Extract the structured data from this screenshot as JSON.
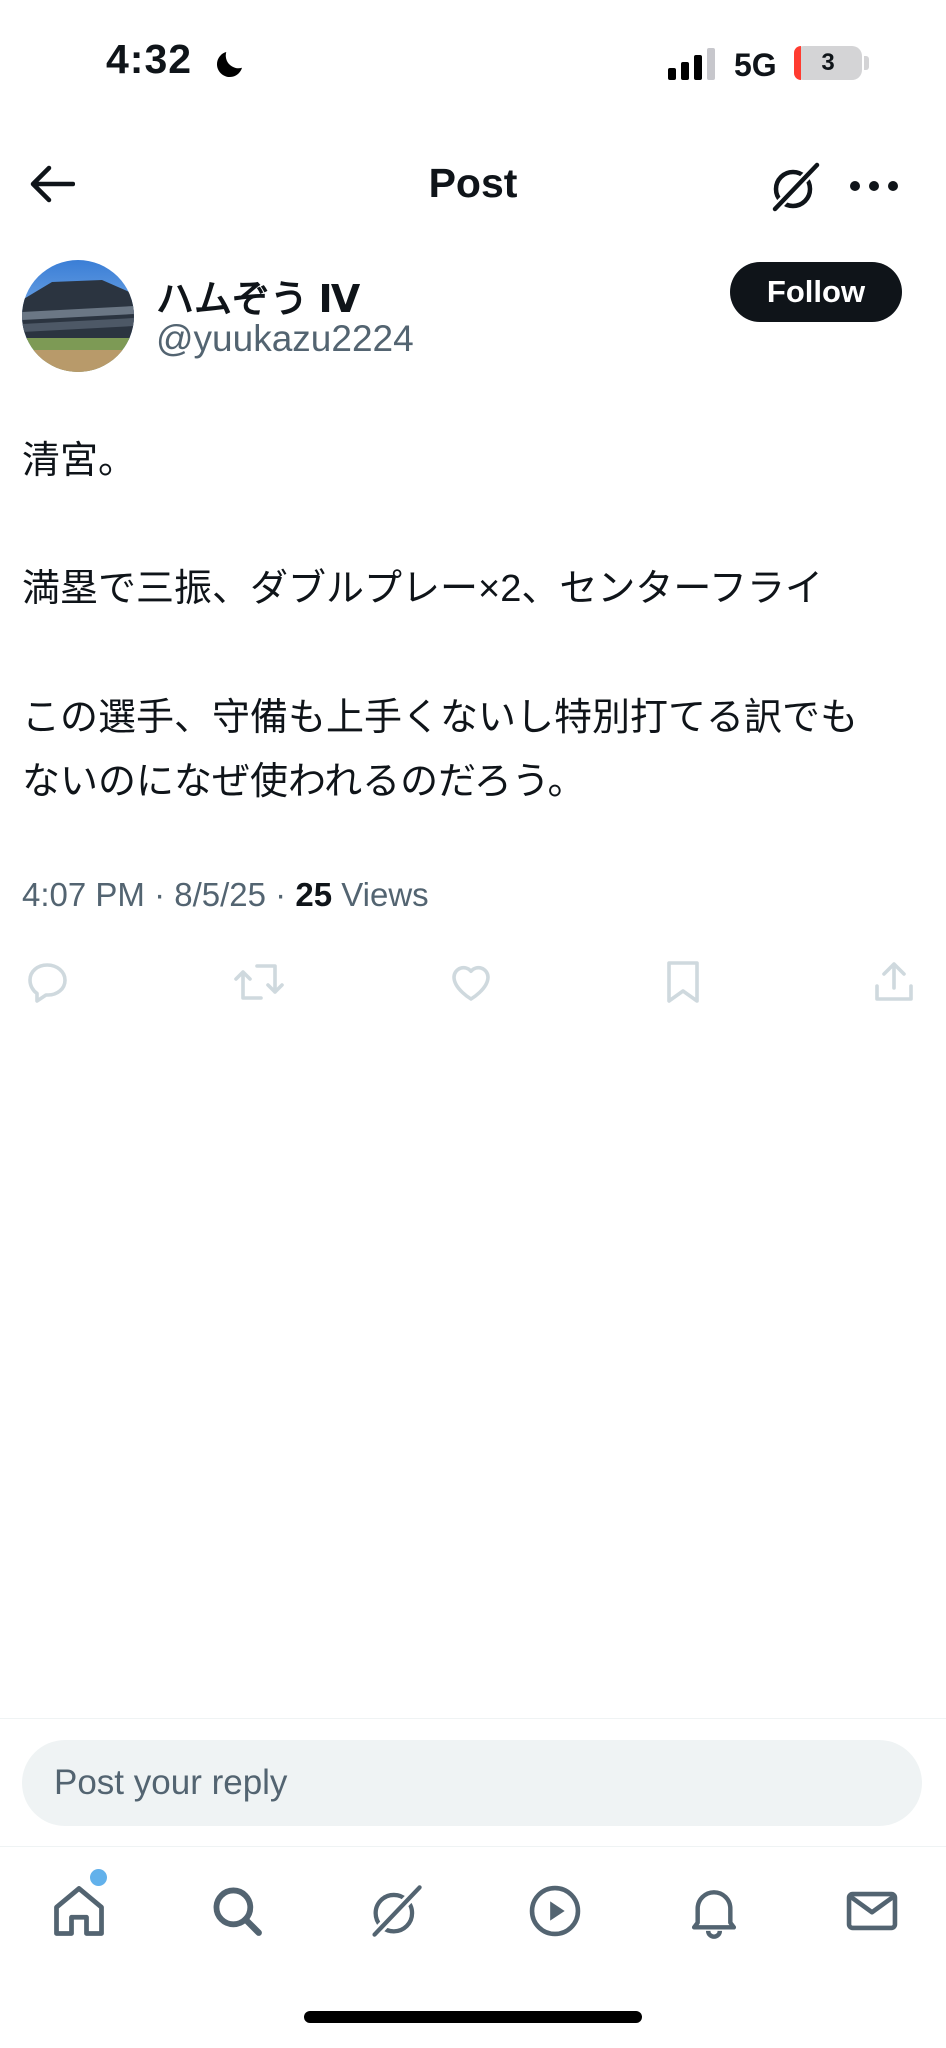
{
  "status_bar": {
    "time": "4:32",
    "network": "5G",
    "battery": "3"
  },
  "header": {
    "title": "Post"
  },
  "author": {
    "display_name": "ハムぞう Ⅳ",
    "handle": "@yuukazu2224",
    "follow_label": "Follow"
  },
  "post": {
    "lines": [
      "清宮。",
      "満塁で三振、ダブルプレー×2、センターフライ",
      "この選手、守備も上手くないし特別打てる訳でも",
      "ないのになぜ使われるのだろう。"
    ],
    "time": "4:07 PM",
    "date": "8/5/25",
    "views_count": "25",
    "views_label": "Views"
  },
  "reply": {
    "placeholder": "Post your reply"
  },
  "icons": {
    "back": "arrow-left-icon",
    "grok": "grok-icon",
    "more": "more-horizontal-icon",
    "reply": "comment-icon",
    "repost": "repost-icon",
    "like": "heart-icon",
    "bookmark": "bookmark-icon",
    "share": "share-icon"
  },
  "colors": {
    "text": "#0f1419",
    "secondary": "#536471",
    "action_icons": "#cfd9de",
    "badge": "#62b1eb"
  }
}
